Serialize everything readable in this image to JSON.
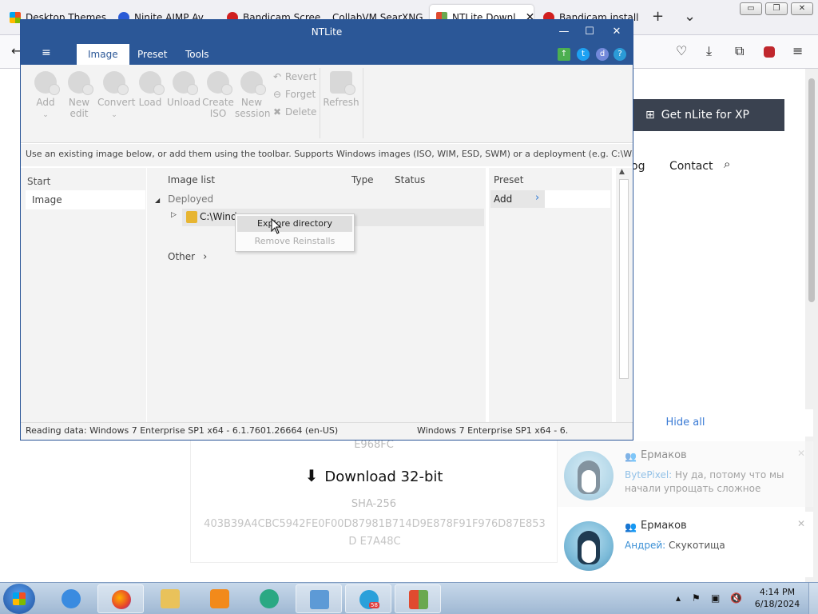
{
  "browser": {
    "tabs": [
      {
        "label": "Desktop Themes",
        "color": "#0078d4"
      },
      {
        "label": "Ninite AIMP Av",
        "color": "#2a5bd7"
      },
      {
        "label": "Bandicam Scree",
        "color": "#d11f1f"
      },
      {
        "label": "CollabVM SearXNG",
        "color": "#555555"
      },
      {
        "label": "NTLite Downl",
        "color": "#e04a2f"
      },
      {
        "label": "Bandicam install",
        "color": "#d11f1f"
      }
    ],
    "new_tab": "+",
    "tab_list": "⌄",
    "window_controls": {
      "minimize": "▭",
      "restore": "❐",
      "close": "✕"
    }
  },
  "webpage": {
    "get_xp": "Get nLite for XP",
    "nav_blog": "og",
    "nav_contact": "Contact",
    "hash_top": "E968FC",
    "download_label": "Download 32-bit",
    "hash_label": "SHA-256",
    "hash_value": "403B39A4CBC5942FE0F00D87981B714D9E878F91F976D87E853D E7A48C"
  },
  "notifications": {
    "hide_all": "Hide all",
    "items": [
      {
        "title": "Ермаков",
        "sender": "BytePixel:",
        "message": " Ну да, потому что мы начали упрощать сложное"
      },
      {
        "title": "Ермаков",
        "sender": "Андрей:",
        "message": " Скукотища"
      }
    ]
  },
  "ntlite": {
    "title": "NTLite",
    "controls": {
      "minimize": "—",
      "maximize": "☐",
      "close": "✕"
    },
    "menu_icon": "≡",
    "tabs": [
      "Image",
      "Preset",
      "Tools"
    ],
    "ribbon": {
      "add": "Add",
      "new_edit": "New edit",
      "convert": "Convert",
      "load": "Load",
      "unload": "Unload",
      "create_iso": "Create ISO",
      "new_session": "New session",
      "revert": "Revert",
      "forget": "Forget",
      "delete": "Delete",
      "refresh": "Refresh"
    },
    "info": "Use an existing image below, or add them using the toolbar. Supports Windows images (ISO, WIM, ESD, SWM) or a deployment (e.g. C:\\Wind...",
    "left": {
      "start": "Start",
      "image": "Image"
    },
    "center": {
      "columns": {
        "image_list": "Image list",
        "type": "Type",
        "status": "Status"
      },
      "deployed": "Deployed",
      "path": "C:\\Wind",
      "other": "Other"
    },
    "preset": {
      "header": "Preset",
      "add": "Add"
    },
    "status_left": "Reading data: Windows 7 Enterprise SP1 x64 - 6.1.7601.26664 (en-US)",
    "status_right": "Windows 7 Enterprise SP1 x64 - 6.",
    "context_menu": {
      "explore": "Explore directory",
      "remove": "Remove Reinstalls"
    }
  },
  "taskbar": {
    "badge": "58",
    "clock_time": "4:14 PM",
    "clock_date": "6/18/2024"
  },
  "colors": {
    "ntlite_blue": "#2b5797",
    "link_blue": "#3a7bd5",
    "taskbar": "#b3c8df"
  }
}
